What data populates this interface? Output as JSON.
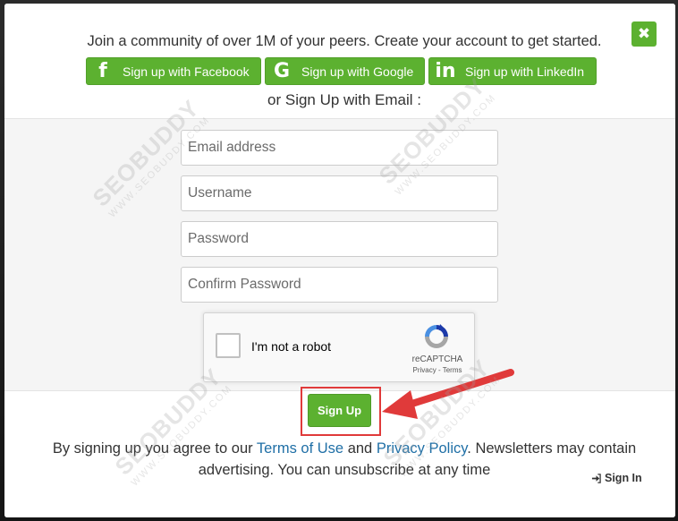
{
  "modal": {
    "intro": "Join a community of over 1M of your peers. Create your account to get started.",
    "close_icon": "close-icon",
    "social": [
      {
        "label": "Sign up with Facebook",
        "icon": "facebook-icon",
        "glyph": "f"
      },
      {
        "label": "Sign up with Google",
        "icon": "google-icon",
        "glyph": "G"
      },
      {
        "label": "Sign up with LinkedIn",
        "icon": "linkedin-icon",
        "glyph": "in"
      }
    ],
    "or_text": "or Sign Up with Email :"
  },
  "form": {
    "email_placeholder": "Email address",
    "username_placeholder": "Username",
    "password_placeholder": "Password",
    "confirm_placeholder": "Confirm Password",
    "recaptcha_label": "I'm not a robot",
    "recaptcha_brand": "reCAPTCHA",
    "recaptcha_links": "Privacy - Terms",
    "submit_label": "Sign Up"
  },
  "footer": {
    "agree_prefix": "By signing up you agree to our ",
    "terms_link": "Terms of Use",
    "and_text": " and ",
    "privacy_link": "Privacy Policy",
    "agree_suffix": ". Newsletters may contain advertising. You can unsubscribe at any time",
    "signin_label": "Sign In",
    "signin_icon": "sign-in-icon"
  },
  "watermark": {
    "brand": "SEOBUDDY",
    "url": "WWW.SEOBUDDY.COM"
  },
  "colors": {
    "accent": "#5cb130",
    "link": "#1f6fa6",
    "highlight": "#e03a3a"
  }
}
